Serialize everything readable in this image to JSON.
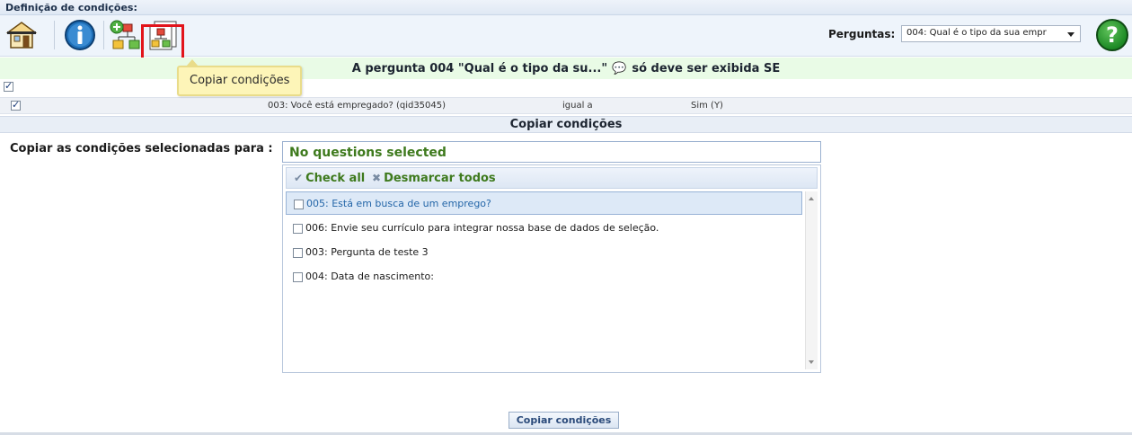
{
  "title_bar": {
    "title": "Definição de condições:"
  },
  "toolbar": {
    "home_icon": "home-icon",
    "info_icon": "info-icon",
    "add_condition_icon": "add-condition-icon",
    "copy_conditions_icon": "copy-conditions-icon",
    "questions_label": "Perguntas:",
    "questions_select_value": "004: Qual é o tipo da sua empr",
    "help_icon": "help-icon",
    "help_glyph": "?"
  },
  "tooltip": {
    "text": "Copiar condições"
  },
  "condition_header": {
    "text_before": "A pergunta 004 \"Qual é o tipo da su...\"",
    "text_after": "só deve ser exibida SE"
  },
  "conditions": [
    {
      "question": "003: Você está empregado? (qid35045)",
      "operator": "igual a",
      "value": "Sim (Y)",
      "checked": true
    }
  ],
  "copy_section": {
    "header": "Copiar condições",
    "label": "Copiar as condições selecionadas para :",
    "multiselect_placeholder": "No questions selected",
    "check_all": "Check all",
    "uncheck_all": "Desmarcar todos",
    "options": [
      {
        "label": "005: Está em busca de um emprego?",
        "checked": false,
        "hover": true
      },
      {
        "label": "006: Envie seu currículo para integrar nossa base de dados de seleção.",
        "checked": false
      },
      {
        "label": "003: Pergunta de teste 3",
        "checked": false
      },
      {
        "label": "004: Data de nascimento:",
        "checked": false
      }
    ],
    "submit_label": "Copiar condições"
  },
  "colors": {
    "highlight": "#e2141b",
    "condition_header_bg": "#e9fbe6",
    "link_green": "#3e7a1d",
    "tooltip_bg": "#fdf5b8"
  }
}
